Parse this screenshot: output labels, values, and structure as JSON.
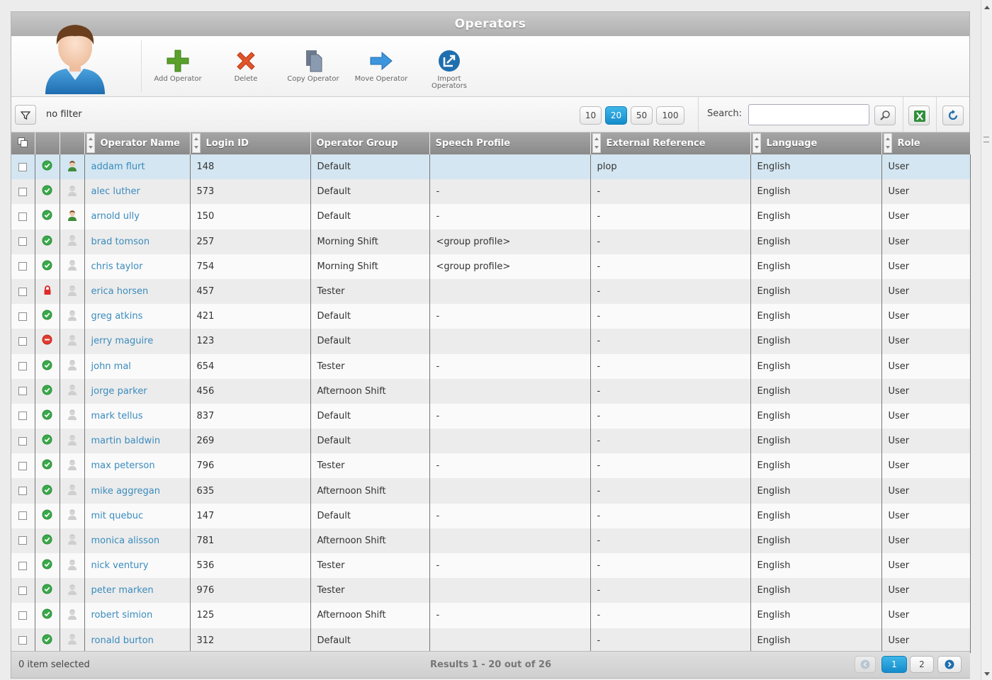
{
  "window": {
    "title": "Operators"
  },
  "toolbar": {
    "buttons": [
      {
        "label": "Add Operator",
        "icon": "plus-icon"
      },
      {
        "label": "Delete",
        "icon": "delete-x-icon"
      },
      {
        "label": "Copy Operator",
        "icon": "copy-icon"
      },
      {
        "label": "Move Operator",
        "icon": "arrow-right-icon"
      },
      {
        "label": "Import Operators",
        "icon": "import-icon"
      }
    ]
  },
  "filter": {
    "text": "no filter"
  },
  "page_size": {
    "options": [
      "10",
      "20",
      "50",
      "100"
    ],
    "selected": "20"
  },
  "search": {
    "label": "Search:",
    "value": ""
  },
  "table": {
    "columns": [
      "Operator Name",
      "Login ID",
      "Operator Group",
      "Speech Profile",
      "External Reference",
      "Language",
      "Role"
    ],
    "rows": [
      {
        "status": "active",
        "avatar": "green",
        "name": "addam flurt",
        "login": "148",
        "group": "Default",
        "speech": "",
        "ext": "plop",
        "lang": "English",
        "role": "User",
        "selected": true
      },
      {
        "status": "active",
        "avatar": "grey",
        "name": "alec luther",
        "login": "573",
        "group": "Default",
        "speech": "-",
        "ext": "-",
        "lang": "English",
        "role": "User"
      },
      {
        "status": "active",
        "avatar": "green",
        "name": "arnold ully",
        "login": "150",
        "group": "Default",
        "speech": "-",
        "ext": "-",
        "lang": "English",
        "role": "User"
      },
      {
        "status": "active",
        "avatar": "grey",
        "name": "brad tomson",
        "login": "257",
        "group": "Morning Shift",
        "speech": "<group profile>",
        "ext": "-",
        "lang": "English",
        "role": "User"
      },
      {
        "status": "active",
        "avatar": "grey",
        "name": "chris taylor",
        "login": "754",
        "group": "Morning Shift",
        "speech": "<group profile>",
        "ext": "-",
        "lang": "English",
        "role": "User"
      },
      {
        "status": "locked",
        "avatar": "grey",
        "name": "erica horsen",
        "login": "457",
        "group": "Tester",
        "speech": "",
        "ext": "-",
        "lang": "English",
        "role": "User"
      },
      {
        "status": "active",
        "avatar": "grey",
        "name": "greg atkins",
        "login": "421",
        "group": "Default",
        "speech": "-",
        "ext": "-",
        "lang": "English",
        "role": "User"
      },
      {
        "status": "disabled",
        "avatar": "grey",
        "name": "jerry maguire",
        "login": "123",
        "group": "Default",
        "speech": "",
        "ext": "-",
        "lang": "English",
        "role": "User"
      },
      {
        "status": "active",
        "avatar": "grey",
        "name": "john mal",
        "login": "654",
        "group": "Tester",
        "speech": "-",
        "ext": "-",
        "lang": "English",
        "role": "User"
      },
      {
        "status": "active",
        "avatar": "grey",
        "name": "jorge parker",
        "login": "456",
        "group": "Afternoon Shift",
        "speech": "",
        "ext": "-",
        "lang": "English",
        "role": "User"
      },
      {
        "status": "active",
        "avatar": "grey",
        "name": "mark tellus",
        "login": "837",
        "group": "Default",
        "speech": "-",
        "ext": "-",
        "lang": "English",
        "role": "User"
      },
      {
        "status": "active",
        "avatar": "grey",
        "name": "martin baldwin",
        "login": "269",
        "group": "Default",
        "speech": "",
        "ext": "-",
        "lang": "English",
        "role": "User"
      },
      {
        "status": "active",
        "avatar": "grey",
        "name": "max peterson",
        "login": "796",
        "group": "Tester",
        "speech": "-",
        "ext": "-",
        "lang": "English",
        "role": "User"
      },
      {
        "status": "active",
        "avatar": "grey",
        "name": "mike aggregan",
        "login": "635",
        "group": "Afternoon Shift",
        "speech": "",
        "ext": "-",
        "lang": "English",
        "role": "User"
      },
      {
        "status": "active",
        "avatar": "grey",
        "name": "mit quebuc",
        "login": "147",
        "group": "Default",
        "speech": "-",
        "ext": "-",
        "lang": "English",
        "role": "User"
      },
      {
        "status": "active",
        "avatar": "grey",
        "name": "monica alisson",
        "login": "781",
        "group": "Afternoon Shift",
        "speech": "",
        "ext": "-",
        "lang": "English",
        "role": "User"
      },
      {
        "status": "active",
        "avatar": "grey",
        "name": "nick ventury",
        "login": "536",
        "group": "Tester",
        "speech": "-",
        "ext": "-",
        "lang": "English",
        "role": "User"
      },
      {
        "status": "active",
        "avatar": "grey",
        "name": "peter marken",
        "login": "976",
        "group": "Tester",
        "speech": "",
        "ext": "-",
        "lang": "English",
        "role": "User"
      },
      {
        "status": "active",
        "avatar": "grey",
        "name": "robert simion",
        "login": "125",
        "group": "Afternoon Shift",
        "speech": "-",
        "ext": "-",
        "lang": "English",
        "role": "User"
      },
      {
        "status": "active",
        "avatar": "grey",
        "name": "ronald burton",
        "login": "312",
        "group": "Default",
        "speech": "",
        "ext": "-",
        "lang": "English",
        "role": "User"
      }
    ]
  },
  "footer": {
    "selection": "0 item selected",
    "results": "Results 1 - 20 out of 26",
    "pages": [
      "1",
      "2"
    ],
    "current_page": "1"
  },
  "colors": {
    "accent": "#1a98d5",
    "link": "#3a8bbd",
    "status_active": "#3aa94a",
    "status_disabled": "#e23b2e",
    "selected_row": "#d4e6f1"
  }
}
